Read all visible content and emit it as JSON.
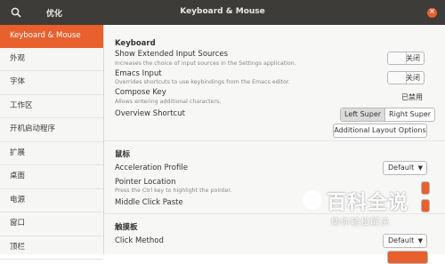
{
  "titlebar": {
    "search_icon": "search-icon",
    "app_title": "优化",
    "window_title": "Keyboard & Mouse",
    "close_glyph": "×"
  },
  "sidebar": {
    "items": [
      {
        "label": "Keyboard & Mouse",
        "active": true
      },
      {
        "label": "外观"
      },
      {
        "label": "字体"
      },
      {
        "label": "工作区"
      },
      {
        "label": "开机启动程序"
      },
      {
        "label": "扩展"
      },
      {
        "label": "桌面"
      },
      {
        "label": "电源"
      },
      {
        "label": "窗口"
      },
      {
        "label": "顶栏"
      }
    ]
  },
  "keyboard": {
    "heading": "Keyboard",
    "extended_sources": {
      "label": "Show Extended Input Sources",
      "desc": "Increases the choice of input sources in the Settings application.",
      "state": "关闭"
    },
    "emacs": {
      "label": "Emacs Input",
      "desc": "Overrides shortcuts to use keybindings from the Emacs editor.",
      "state": "关闭"
    },
    "compose": {
      "label": "Compose Key",
      "desc": "Allows entering additional characters.",
      "state": "已禁用"
    },
    "overview": {
      "label": "Overview Shortcut",
      "left": "Left Super",
      "right": "Right Super"
    },
    "layout_button": "Additional Layout Options"
  },
  "mouse": {
    "heading": "鼠标",
    "accel": {
      "label": "Acceleration Profile",
      "value": "Default"
    },
    "pointer": {
      "label": "Pointer Location",
      "desc": "Press the Ctrl key to highlight the pointer."
    },
    "middle": {
      "label": "Middle Click Paste"
    }
  },
  "touchpad": {
    "heading": "触摸板",
    "click": {
      "label": "Click Method",
      "value": "Default"
    }
  },
  "watermark": {
    "big": "百科全说",
    "small": "助你轻松解决"
  },
  "colors": {
    "accent": "#e9602f",
    "titlebar": "#3d3c39"
  }
}
